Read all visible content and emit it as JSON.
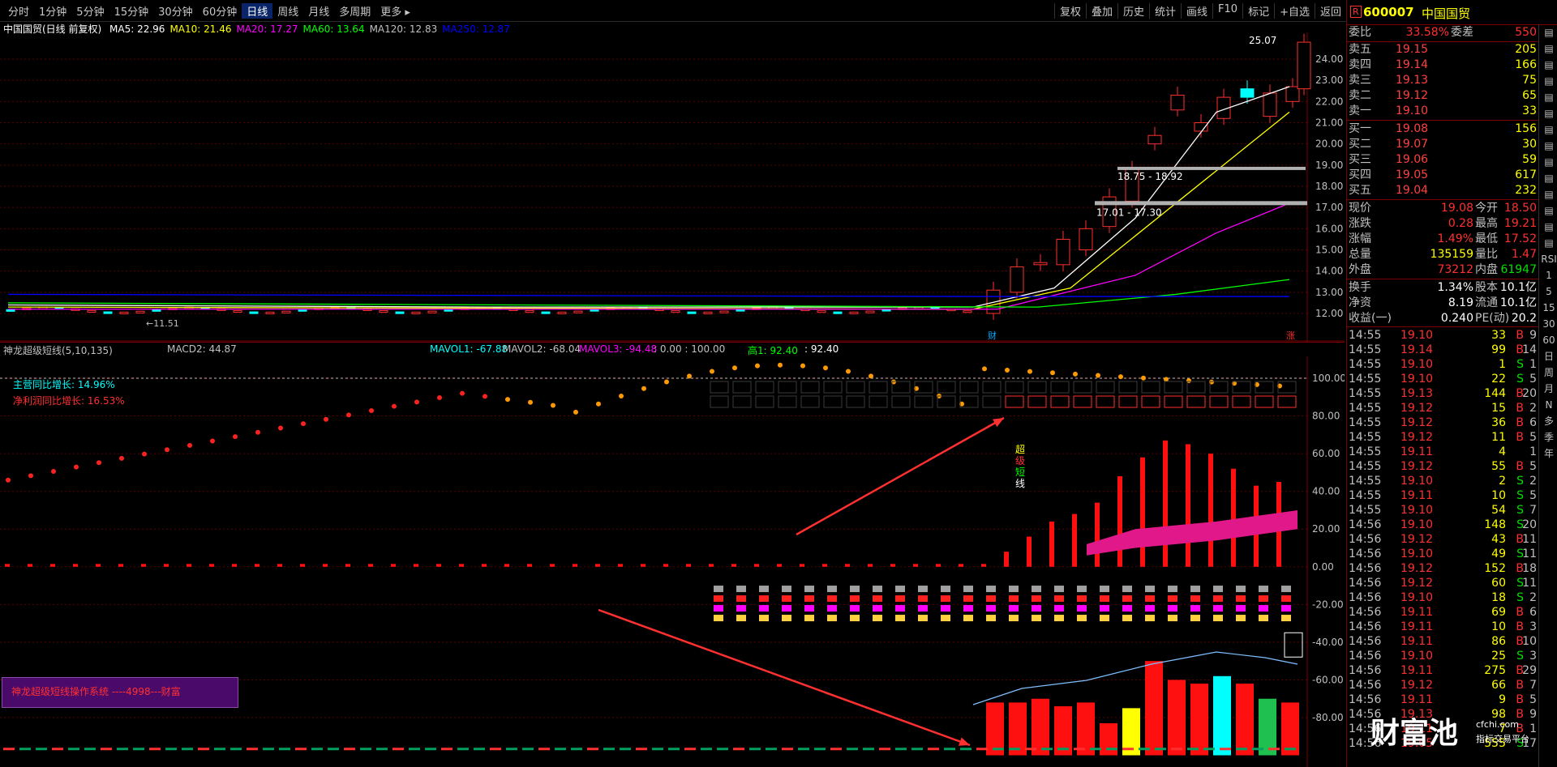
{
  "toolbar": {
    "period_tabs": [
      "分时",
      "1分钟",
      "5分钟",
      "15分钟",
      "30分钟",
      "60分钟",
      "日线",
      "周线",
      "月线",
      "多周期",
      "更多"
    ],
    "active_tab": "日线",
    "right_tools": [
      "复权",
      "叠加",
      "历史",
      "统计",
      "画线",
      "F10",
      "标记",
      "+自选",
      "返回"
    ]
  },
  "main_chart": {
    "title": "中国国贸(日线 前复权)",
    "ma": [
      {
        "label": "MA5: 22.96",
        "color": "#ffffff"
      },
      {
        "label": "MA10: 21.46",
        "color": "#ffff00"
      },
      {
        "label": "MA20: 17.27",
        "color": "#ff00ff"
      },
      {
        "label": "MA60: 13.64",
        "color": "#00ff00"
      },
      {
        "label": "MA120: 12.83",
        "color": "#c0c0c0"
      },
      {
        "label": "MA250: 12.87",
        "color": "#0000ff"
      }
    ],
    "y_ticks": [
      "24.00",
      "23.00",
      "22.00",
      "21.00",
      "20.00",
      "19.00",
      "18.00",
      "17.00",
      "16.00",
      "15.00",
      "14.00",
      "13.00",
      "12.00"
    ],
    "high_label": "25.07",
    "low_label": "11.51",
    "zone1": "18.75 - 18.92",
    "zone2": "17.01 - 17.30",
    "marker_cai": "财",
    "marker_zhang": "涨"
  },
  "sub_chart": {
    "indicator": "神龙超级短线(5,10,135)",
    "macd2": "MACD2: 44.87",
    "mavol1": "MAVOL1: -67.88",
    "mavol2": "MAVOL2: -68.04",
    "mavol3": "MAVOL3: -94.48",
    "extra": ": 0.00 : 100.00",
    "gao": "高1: 92.40",
    "gao_val": ": 92.40",
    "main_growth": "主营同比增长: 14.96%",
    "profit_growth": "净利润同比增长: 16.53%",
    "vertical_label": [
      "超",
      "级",
      "短",
      "线"
    ],
    "y_ticks": [
      "100.00",
      "80.00",
      "60.00",
      "40.00",
      "20.00",
      "0.00",
      "-20.00",
      "-40.00",
      "-60.00",
      "-80.00"
    ],
    "promo": "神龙超级短线操作系统 ----4998---财富"
  },
  "side_panel": {
    "code": "600007",
    "name": "中国国贸",
    "weibi_label": "委比",
    "weibi": "33.58%",
    "weicha_label": "委差",
    "weicha": "550",
    "asks": [
      {
        "label": "卖五",
        "price": "19.15",
        "qty": "205"
      },
      {
        "label": "卖四",
        "price": "19.14",
        "qty": "166"
      },
      {
        "label": "卖三",
        "price": "19.13",
        "qty": "75"
      },
      {
        "label": "卖二",
        "price": "19.12",
        "qty": "65"
      },
      {
        "label": "卖一",
        "price": "19.10",
        "qty": "33"
      }
    ],
    "bids": [
      {
        "label": "买一",
        "price": "19.08",
        "qty": "156"
      },
      {
        "label": "买二",
        "price": "19.07",
        "qty": "30"
      },
      {
        "label": "买三",
        "price": "19.06",
        "qty": "59"
      },
      {
        "label": "买四",
        "price": "19.05",
        "qty": "617"
      },
      {
        "label": "买五",
        "price": "19.04",
        "qty": "232"
      }
    ],
    "stats": [
      {
        "l": "现价",
        "v": "19.08",
        "vc": "red",
        "l2": "今开",
        "v2": "18.50",
        "v2c": "red"
      },
      {
        "l": "涨跌",
        "v": "0.28",
        "vc": "red",
        "l2": "最高",
        "v2": "19.21",
        "v2c": "red"
      },
      {
        "l": "涨幅",
        "v": "1.49%",
        "vc": "red",
        "l2": "最低",
        "v2": "17.52",
        "v2c": "red"
      },
      {
        "l": "总量",
        "v": "135159",
        "vc": "yellow",
        "l2": "量比",
        "v2": "1.47",
        "v2c": "red"
      },
      {
        "l": "外盘",
        "v": "73212",
        "vc": "red",
        "l2": "内盘",
        "v2": "61947",
        "v2c": "green"
      }
    ],
    "stats2": [
      {
        "l": "换手",
        "v": "1.34%",
        "vc": "white",
        "l2": "股本",
        "v2": "10.1亿",
        "v2c": "white"
      },
      {
        "l": "净资",
        "v": "8.19",
        "vc": "white",
        "l2": "流通",
        "v2": "10.1亿",
        "v2c": "white"
      },
      {
        "l": "收益(一)",
        "v": "0.240",
        "vc": "white",
        "l2": "PE(动)",
        "v2": "20.2",
        "v2c": "white"
      }
    ],
    "ticks": [
      {
        "t": "14:55",
        "p": "19.10",
        "q": "33",
        "bs": "B",
        "n": "9",
        "pc": "red",
        "bc": "red"
      },
      {
        "t": "14:55",
        "p": "19.14",
        "q": "99",
        "bs": "B",
        "n": "14",
        "pc": "red",
        "bc": "red"
      },
      {
        "t": "14:55",
        "p": "19.10",
        "q": "1",
        "bs": "S",
        "n": "1",
        "pc": "red",
        "bc": "green"
      },
      {
        "t": "14:55",
        "p": "19.10",
        "q": "22",
        "bs": "S",
        "n": "5",
        "pc": "red",
        "bc": "green"
      },
      {
        "t": "14:55",
        "p": "19.13",
        "q": "144",
        "bs": "B",
        "n": "20",
        "pc": "red",
        "bc": "red"
      },
      {
        "t": "14:55",
        "p": "19.12",
        "q": "15",
        "bs": "B",
        "n": "2",
        "pc": "red",
        "bc": "red"
      },
      {
        "t": "14:55",
        "p": "19.12",
        "q": "36",
        "bs": "B",
        "n": "6",
        "pc": "red",
        "bc": "red"
      },
      {
        "t": "14:55",
        "p": "19.12",
        "q": "11",
        "bs": "B",
        "n": "5",
        "pc": "red",
        "bc": "red"
      },
      {
        "t": "14:55",
        "p": "19.11",
        "q": "4",
        "bs": "",
        "n": "1",
        "pc": "red",
        "bc": "red"
      },
      {
        "t": "14:55",
        "p": "19.12",
        "q": "55",
        "bs": "B",
        "n": "5",
        "pc": "red",
        "bc": "red"
      },
      {
        "t": "14:55",
        "p": "19.10",
        "q": "2",
        "bs": "S",
        "n": "2",
        "pc": "red",
        "bc": "green"
      },
      {
        "t": "14:55",
        "p": "19.11",
        "q": "10",
        "bs": "S",
        "n": "5",
        "pc": "red",
        "bc": "green"
      },
      {
        "t": "14:55",
        "p": "19.10",
        "q": "54",
        "bs": "S",
        "n": "7",
        "pc": "red",
        "bc": "green"
      },
      {
        "t": "14:56",
        "p": "19.10",
        "q": "148",
        "bs": "S",
        "n": "20",
        "pc": "red",
        "bc": "green"
      },
      {
        "t": "14:56",
        "p": "19.12",
        "q": "43",
        "bs": "B",
        "n": "11",
        "pc": "red",
        "bc": "red"
      },
      {
        "t": "14:56",
        "p": "19.10",
        "q": "49",
        "bs": "S",
        "n": "11",
        "pc": "red",
        "bc": "green"
      },
      {
        "t": "14:56",
        "p": "19.12",
        "q": "152",
        "bs": "B",
        "n": "18",
        "pc": "red",
        "bc": "red"
      },
      {
        "t": "14:56",
        "p": "19.12",
        "q": "60",
        "bs": "S",
        "n": "11",
        "pc": "red",
        "bc": "green"
      },
      {
        "t": "14:56",
        "p": "19.10",
        "q": "18",
        "bs": "S",
        "n": "2",
        "pc": "red",
        "bc": "green"
      },
      {
        "t": "14:56",
        "p": "19.11",
        "q": "69",
        "bs": "B",
        "n": "6",
        "pc": "red",
        "bc": "red"
      },
      {
        "t": "14:56",
        "p": "19.11",
        "q": "10",
        "bs": "B",
        "n": "3",
        "pc": "red",
        "bc": "red"
      },
      {
        "t": "14:56",
        "p": "19.11",
        "q": "86",
        "bs": "B",
        "n": "10",
        "pc": "red",
        "bc": "red"
      },
      {
        "t": "14:56",
        "p": "19.10",
        "q": "25",
        "bs": "S",
        "n": "3",
        "pc": "red",
        "bc": "green"
      },
      {
        "t": "14:56",
        "p": "19.11",
        "q": "275",
        "bs": "B",
        "n": "29",
        "pc": "red",
        "bc": "red"
      },
      {
        "t": "14:56",
        "p": "19.12",
        "q": "66",
        "bs": "B",
        "n": "7",
        "pc": "red",
        "bc": "red"
      },
      {
        "t": "14:56",
        "p": "19.11",
        "q": "9",
        "bs": "B",
        "n": "5",
        "pc": "red",
        "bc": "red"
      },
      {
        "t": "14:56",
        "p": "19.13",
        "q": "98",
        "bs": "B",
        "n": "9",
        "pc": "red",
        "bc": "red"
      },
      {
        "t": "14:56",
        "p": "19.11",
        "q": "7",
        "bs": "B",
        "n": "1",
        "pc": "red",
        "bc": "red"
      },
      {
        "t": "14:56",
        "p": "19.05",
        "q": "555",
        "bs": "S",
        "n": "17",
        "pc": "red",
        "bc": "green"
      }
    ],
    "side_icons": [
      "RSI",
      "1",
      "5",
      "15",
      "30",
      "60",
      "日",
      "周",
      "月",
      "N",
      "多",
      "季",
      "年"
    ]
  },
  "watermark": {
    "text": "财富池",
    "sub1": "cfchi.com",
    "sub2": "指标交易平台"
  }
}
